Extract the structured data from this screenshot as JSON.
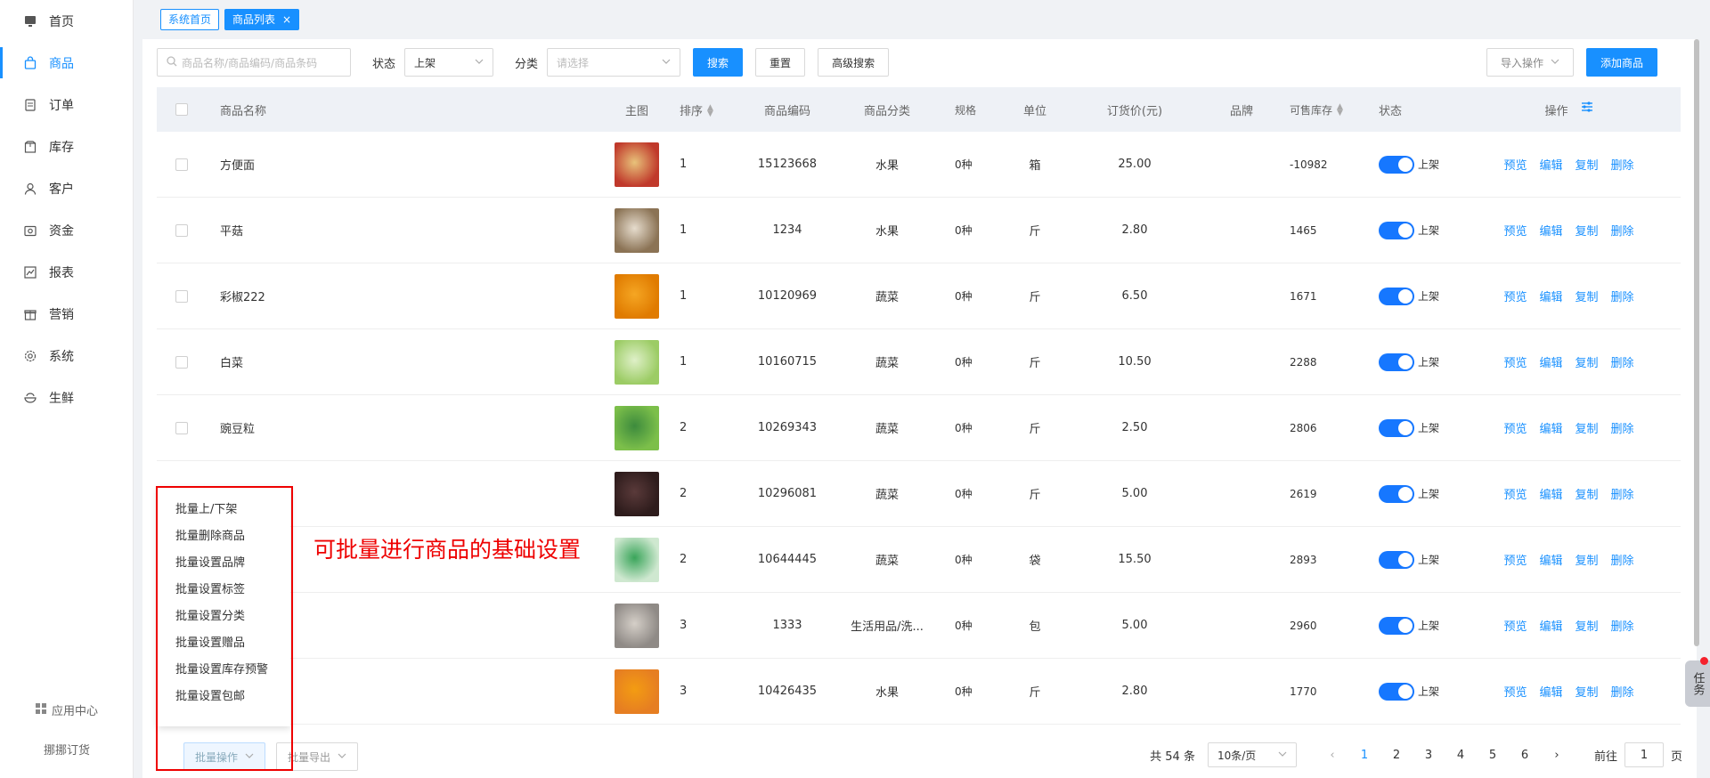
{
  "sidebar": {
    "items": [
      {
        "label": "首页",
        "icon": "monitor-icon"
      },
      {
        "label": "商品",
        "icon": "bag-icon"
      },
      {
        "label": "订单",
        "icon": "document-icon"
      },
      {
        "label": "库存",
        "icon": "box-icon"
      },
      {
        "label": "客户",
        "icon": "user-icon"
      },
      {
        "label": "资金",
        "icon": "wallet-icon"
      },
      {
        "label": "报表",
        "icon": "chart-icon"
      },
      {
        "label": "营销",
        "icon": "gift-icon"
      },
      {
        "label": "系统",
        "icon": "gear-icon"
      },
      {
        "label": "生鲜",
        "icon": "bowl-icon"
      }
    ],
    "app_center": "应用中心",
    "brand": "挪挪订货"
  },
  "tabs": {
    "home": "系统首页",
    "current": "商品列表",
    "close": "×"
  },
  "toolbar": {
    "search_placeholder": "商品名称/商品编码/商品条码",
    "status_label": "状态",
    "status_value": "上架",
    "category_label": "分类",
    "category_placeholder": "请选择",
    "search_btn": "搜索",
    "reset_btn": "重置",
    "advanced_btn": "高级搜索",
    "import_btn": "导入操作",
    "add_btn": "添加商品"
  },
  "table": {
    "headers": {
      "name": "商品名称",
      "img": "主图",
      "sort": "排序",
      "code": "商品编码",
      "cat": "商品分类",
      "spec": "规格",
      "unit": "单位",
      "price": "订货价(元)",
      "brand": "品牌",
      "stock": "可售库存",
      "status": "状态",
      "ops": "操作"
    },
    "ops": {
      "preview": "预览",
      "edit": "编辑",
      "copy": "复制",
      "delete": "删除"
    },
    "rows": [
      {
        "name": "方便面",
        "sort": "1",
        "code": "15123668",
        "cat": "水果",
        "spec": "0种",
        "unit": "箱",
        "price": "25.00",
        "stock": "-10982",
        "status": "上架"
      },
      {
        "name": "平菇",
        "sort": "1",
        "code": "1234",
        "cat": "水果",
        "spec": "0种",
        "unit": "斤",
        "price": "2.80",
        "stock": "1465",
        "status": "上架"
      },
      {
        "name": "彩椒222",
        "sort": "1",
        "code": "10120969",
        "cat": "蔬菜",
        "spec": "0种",
        "unit": "斤",
        "price": "6.50",
        "stock": "1671",
        "status": "上架"
      },
      {
        "name": "白菜",
        "sort": "1",
        "code": "10160715",
        "cat": "蔬菜",
        "spec": "0种",
        "unit": "斤",
        "price": "10.50",
        "stock": "2288",
        "status": "上架"
      },
      {
        "name": "豌豆粒",
        "sort": "2",
        "code": "10269343",
        "cat": "蔬菜",
        "spec": "0种",
        "unit": "斤",
        "price": "2.50",
        "stock": "2806",
        "status": "上架"
      },
      {
        "name": "",
        "sort": "2",
        "code": "10296081",
        "cat": "蔬菜",
        "spec": "0种",
        "unit": "斤",
        "price": "5.00",
        "stock": "2619",
        "status": "上架"
      },
      {
        "name": "",
        "sort": "2",
        "code": "10644445",
        "cat": "蔬菜",
        "spec": "0种",
        "unit": "袋",
        "price": "15.50",
        "stock": "2893",
        "status": "上架"
      },
      {
        "name": "",
        "sort": "3",
        "code": "1333",
        "cat": "生活用品/洗...",
        "spec": "0种",
        "unit": "包",
        "price": "5.00",
        "stock": "2960",
        "status": "上架"
      },
      {
        "name": "",
        "sort": "3",
        "code": "10426435",
        "cat": "水果",
        "spec": "0种",
        "unit": "斤",
        "price": "2.80",
        "stock": "1770",
        "status": "上架"
      }
    ]
  },
  "footer": {
    "batch_btn": "批量操作",
    "export_btn": "批量导出",
    "total": "共 54 条",
    "page_size": "10条/页",
    "pages": [
      "1",
      "2",
      "3",
      "4",
      "5",
      "6"
    ],
    "current_page": "1",
    "goto_label": "前往",
    "goto_value": "1",
    "page_unit": "页"
  },
  "dropdown": {
    "items": [
      "批量上/下架",
      "批量删除商品",
      "批量设置品牌",
      "批量设置标签",
      "批量设置分类",
      "批量设置赠品",
      "批量设置库存预警",
      "批量设置包邮"
    ]
  },
  "annotation": "可批量进行商品的基础设置",
  "float_task": "任务",
  "colors": {
    "accent": "#1890ff",
    "annotation": "#e00000"
  }
}
